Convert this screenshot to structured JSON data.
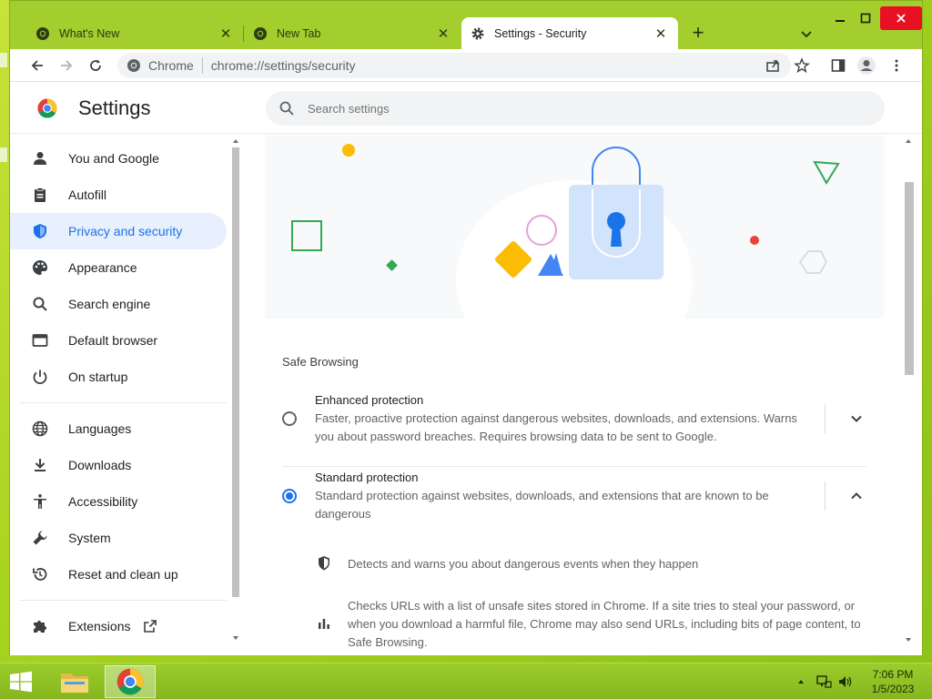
{
  "browser": {
    "tabs": [
      {
        "title": "What's New",
        "icon": "chrome-icon"
      },
      {
        "title": "New Tab",
        "icon": "chrome-icon"
      },
      {
        "title": "Settings - Security",
        "icon": "gear-icon",
        "active": true
      }
    ],
    "omnibox": {
      "site": "Chrome",
      "url": "chrome://settings/security"
    }
  },
  "settings": {
    "title": "Settings",
    "search_placeholder": "Search settings",
    "nav": [
      {
        "label": "You and Google",
        "icon": "person-icon"
      },
      {
        "label": "Autofill",
        "icon": "clipboard-icon"
      },
      {
        "label": "Privacy and security",
        "icon": "shield-icon",
        "active": true
      },
      {
        "label": "Appearance",
        "icon": "palette-icon"
      },
      {
        "label": "Search engine",
        "icon": "search-icon"
      },
      {
        "label": "Default browser",
        "icon": "browser-window-icon"
      },
      {
        "label": "On startup",
        "icon": "power-icon"
      },
      {
        "label": "Languages",
        "icon": "globe-icon"
      },
      {
        "label": "Downloads",
        "icon": "download-icon"
      },
      {
        "label": "Accessibility",
        "icon": "accessibility-icon"
      },
      {
        "label": "System",
        "icon": "wrench-icon"
      },
      {
        "label": "Reset and clean up",
        "icon": "reset-icon"
      },
      {
        "label": "Extensions",
        "icon": "puzzle-icon"
      }
    ]
  },
  "safe_browsing": {
    "section_title": "Safe Browsing",
    "enhanced": {
      "label": "Enhanced protection",
      "description": "Faster, proactive protection against dangerous websites, downloads, and extensions. Warns you about password breaches. Requires browsing data to be sent to Google.",
      "selected": false
    },
    "standard": {
      "label": "Standard protection",
      "description": "Standard protection against websites, downloads, and extensions that are known to be dangerous",
      "selected": true,
      "details": [
        {
          "icon": "shield-icon",
          "text": "Detects and warns you about dangerous events when they happen"
        },
        {
          "icon": "bar-chart-icon",
          "text": "Checks URLs with a list of unsafe sites stored in Chrome. If a site tries to steal your password, or when you download a harmful file, Chrome may also send URLs, including bits of page content, to Safe Browsing."
        }
      ]
    }
  },
  "taskbar": {
    "time": "7:06 PM",
    "date": "1/5/2023"
  },
  "colors": {
    "accent": "#1a73e8",
    "active_nav_bg": "#e8f0fe",
    "desktop": "#a6d21f"
  }
}
